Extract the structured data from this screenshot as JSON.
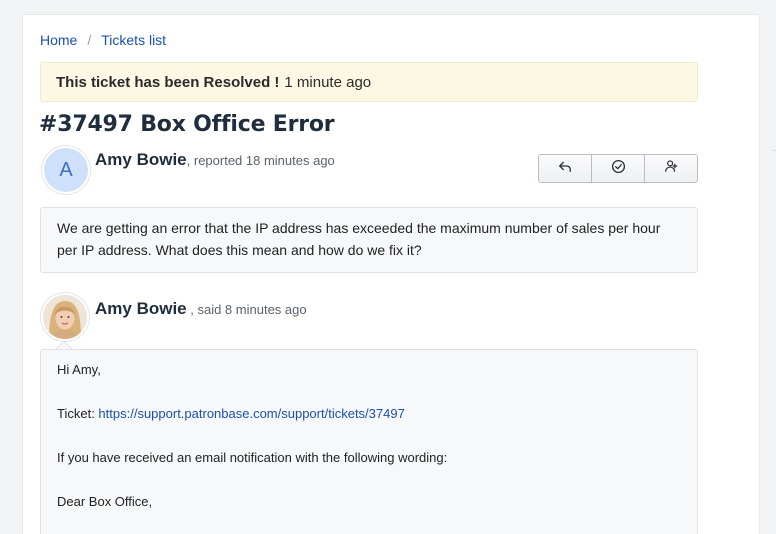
{
  "breadcrumb": {
    "home": "Home",
    "separator": "/",
    "tickets_list": "Tickets list"
  },
  "alert": {
    "strong": "This ticket has been Resolved !",
    "time": "1 minute ago"
  },
  "ticket": {
    "title": "#37497 Box Office Error"
  },
  "report": {
    "avatar_letter": "A",
    "author": "Amy Bowie",
    "meta": ", reported 18 minutes ago",
    "body": "We are getting an error that the IP address has exceeded the maximum number of sales per hour per IP address. What does this mean and how do we fix it?"
  },
  "actions": {
    "icons": [
      "reply-icon",
      "resolve-check-icon",
      "assign-user-icon"
    ]
  },
  "reply": {
    "author": "Amy Bowie",
    "meta": " , said 8 minutes ago",
    "greeting": "Hi Amy,",
    "ticket_label": "Ticket: ",
    "ticket_link": "https://support.patronbase.com/support/tickets/37497",
    "line3": "If you have  received an email notification with the following wording:",
    "line4": "Dear Box Office,"
  },
  "colors": {
    "link": "#1a4fb4",
    "alert_bg": "#fcf8e3",
    "avatar_bg": "#cfe0fb"
  }
}
